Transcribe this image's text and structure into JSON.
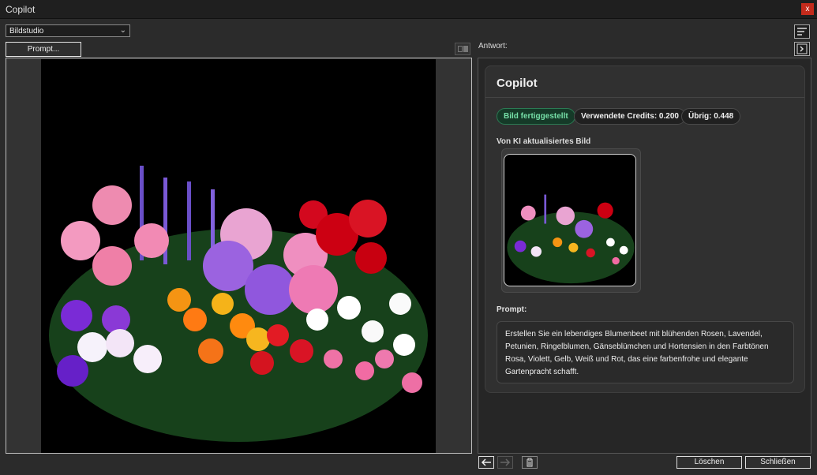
{
  "window": {
    "title": "Copilot",
    "close_label": "x"
  },
  "toolbar": {
    "mode_select": "Bildstudio",
    "prompt_button": "Prompt..."
  },
  "response": {
    "label": "Antwort:",
    "card_title": "Copilot",
    "badges": {
      "status": "Bild fertiggestellt",
      "credits": "Verwendete Credits: 0.200",
      "remaining": "Übrig: 0.448"
    },
    "image_heading": "Von KI aktualisiertes Bild",
    "prompt_heading": "Prompt:",
    "prompt_text": "Erstellen Sie ein lebendiges Blumenbeet mit blühenden Rosen, Lavendel, Petunien, Ringelblumen, Gänseblümchen und Hortensien in den Farbtönen Rosa, Violett, Gelb, Weiß und Rot, das eine farbenfrohe und elegante Gartenpracht schafft."
  },
  "footer": {
    "delete_button": "Löschen",
    "close_button": "Schließen"
  },
  "icons": {
    "compare": "compare-icon",
    "sort": "sort-icon",
    "panel": "panel-toggle-icon",
    "back": "arrow-left-icon",
    "forward": "arrow-right-icon",
    "trash": "trash-icon",
    "dropdown": "chevron-down-icon"
  },
  "colors": {
    "status_green": "#76e0a8",
    "background": "#2b2b2b",
    "close_red": "#c42b1c"
  }
}
